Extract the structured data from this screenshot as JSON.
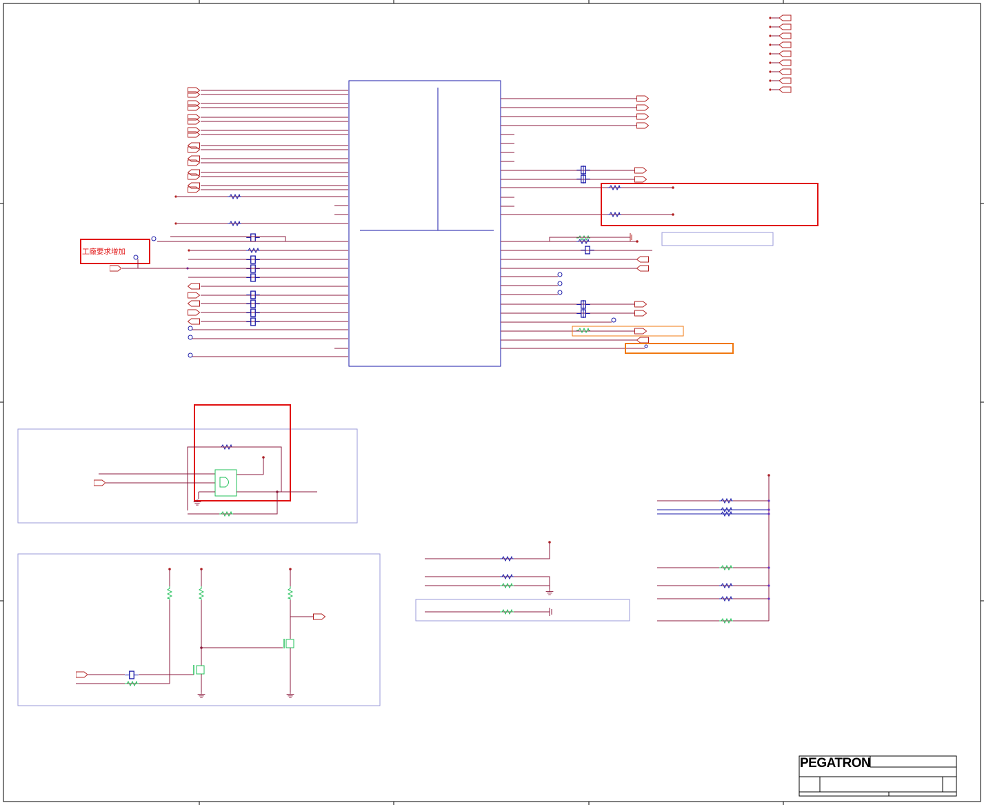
{
  "annotation": {
    "text": "工廠要求增加"
  },
  "title_block": {
    "company": "PEGATRON"
  },
  "colors": {
    "wire": "#8b1a3c",
    "net": "#b22222",
    "part": "#1a1aa8",
    "part_alt": "#22c05a",
    "frame": "#000000",
    "highlight_red": "#e01010",
    "highlight_orange": "#f07810",
    "group_box": "#9a9ad8"
  }
}
